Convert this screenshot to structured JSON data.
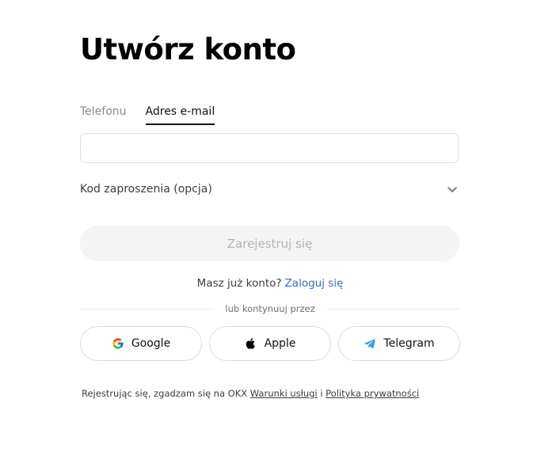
{
  "title": "Utwórz konto",
  "tabs": [
    {
      "label": "Telefonu",
      "active": false
    },
    {
      "label": "Adres e-mail",
      "active": true
    }
  ],
  "email_input": {
    "value": "",
    "placeholder": ""
  },
  "referral": {
    "label": "Kod zaproszenia (opcja)",
    "icon": "chevron-down-icon"
  },
  "register_button": {
    "label": "Zarejestruj się",
    "disabled": true
  },
  "login_prompt": {
    "text": "Masz już konto?",
    "link": "Zaloguj się"
  },
  "divider_text": "lub kontynuuj przez",
  "social": [
    {
      "label": "Google",
      "icon": "google-icon"
    },
    {
      "label": "Apple",
      "icon": "apple-icon"
    },
    {
      "label": "Telegram",
      "icon": "telegram-icon"
    }
  ],
  "legal": {
    "prefix": "Rejestrując się, zgadzam się na OKX",
    "terms": "Warunki usługi",
    "separator": "i",
    "privacy": "Polityka prywatności"
  },
  "colors": {
    "link": "#2f6fc6",
    "disabled_button_bg": "#f4f4f4",
    "disabled_button_text": "#b4b4b4",
    "telegram": "#2aa3df"
  }
}
